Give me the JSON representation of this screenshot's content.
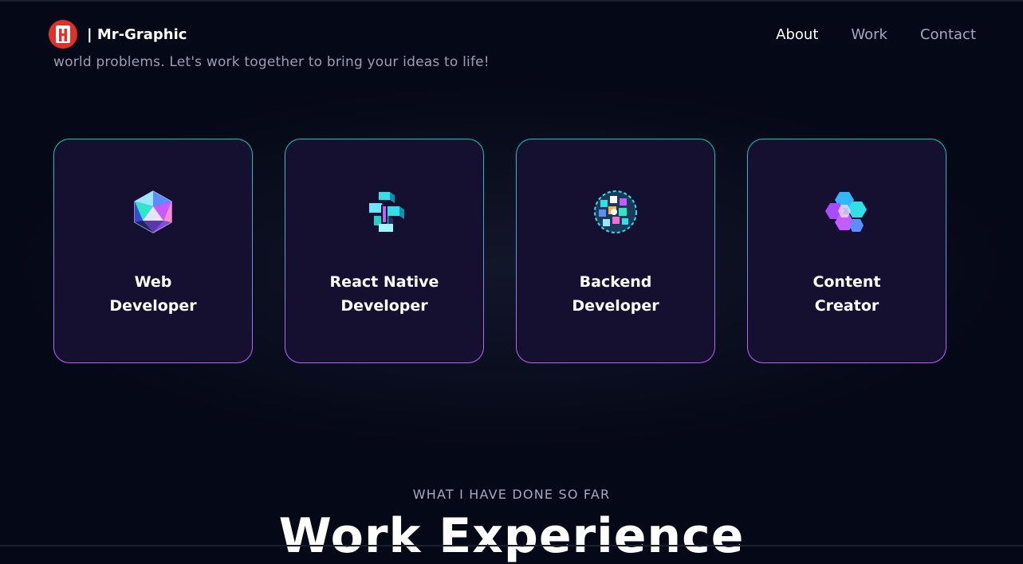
{
  "intro": {
    "text": "world problems. Let's work together to bring your ideas to life!"
  },
  "nav": {
    "logo_icon": "logo-badge-icon",
    "logo_text": "| Mr-Graphic",
    "links": [
      {
        "label": "About",
        "active": true
      },
      {
        "label": "Work",
        "active": false
      },
      {
        "label": "Contact",
        "active": false
      }
    ]
  },
  "services": [
    {
      "line1": "Web",
      "line2": "Developer",
      "icon": "icosahedron-icon"
    },
    {
      "line1": "React Native",
      "line2": "Developer",
      "icon": "cube-structure-icon"
    },
    {
      "line1": "Backend",
      "line2": "Developer",
      "icon": "sphere-mosaic-icon"
    },
    {
      "line1": "Content",
      "line2": "Creator",
      "icon": "hex-cluster-icon"
    }
  ],
  "experience": {
    "subtitle": "WHAT I HAVE DONE SO FAR",
    "heading": "Work Experience"
  },
  "colors": {
    "background": "#050816",
    "card": "#151030",
    "gradient_start": "#00cea8",
    "gradient_end": "#bf61ff",
    "secondary_text": "#aaa6c3",
    "logo_red": "#e0302a"
  }
}
